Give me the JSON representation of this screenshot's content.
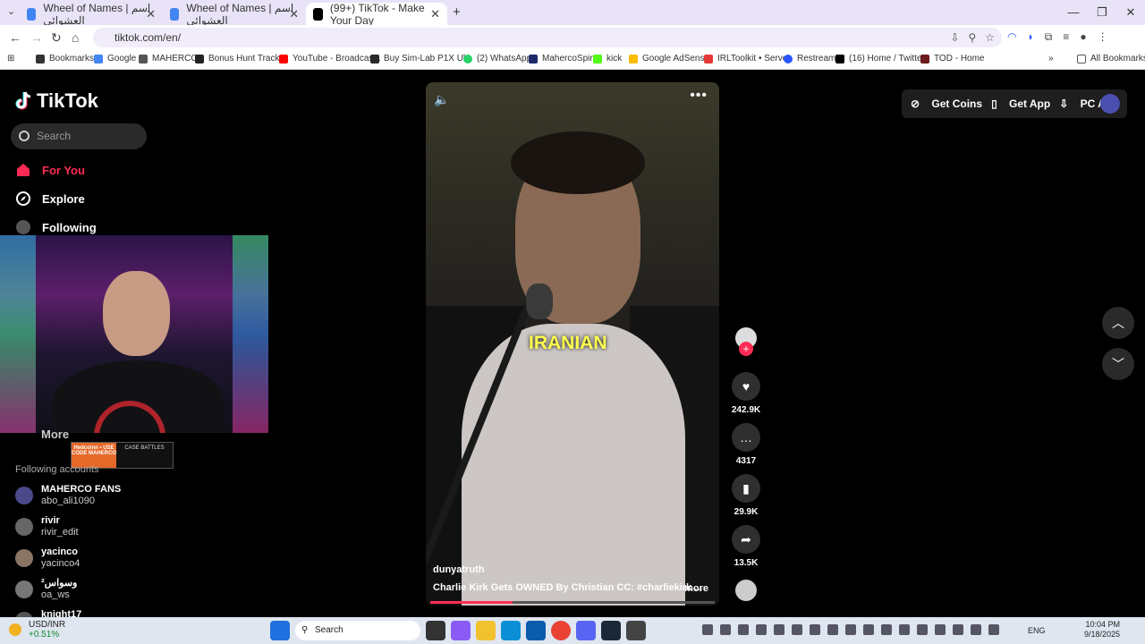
{
  "browser": {
    "tabs": [
      {
        "label": "Wheel of Names | اسم العشوائي",
        "active": false
      },
      {
        "label": "Wheel of Names | اسم العشوائي",
        "active": false
      },
      {
        "label": "(99+) TikTok - Make Your Day",
        "active": true
      }
    ],
    "new_tab": "+",
    "url": "tiktok.com/en/",
    "bookmarks": [
      {
        "label": "Bookmarks",
        "icon": "star-icon",
        "color": "#333333"
      },
      {
        "label": "Google",
        "icon": "google-icon",
        "color": "#4285f4"
      },
      {
        "label": "MAHERCO",
        "icon": "maherco-icon",
        "color": "#555555"
      },
      {
        "label": "Bonus Hunt Tracker",
        "icon": "tracker-icon",
        "color": "#222222"
      },
      {
        "label": "YouTube - Broadcas...",
        "icon": "youtube-icon",
        "color": "#ff0000"
      },
      {
        "label": "Buy Sim-Lab P1X Ul...",
        "icon": "simlab-icon",
        "color": "#2a2a2a"
      },
      {
        "label": "(2) WhatsApp",
        "icon": "whatsapp-icon",
        "color": "#25d366"
      },
      {
        "label": "MahercoSpin",
        "icon": "spin-icon",
        "color": "#1f2a6b"
      },
      {
        "label": "kick",
        "icon": "kick-icon",
        "color": "#53fc18"
      },
      {
        "label": "Google AdSense",
        "icon": "adsense-icon",
        "color": "#fbbc04"
      },
      {
        "label": "IRLToolkit • Server",
        "icon": "irl-icon",
        "color": "#e53935"
      },
      {
        "label": "Restream",
        "icon": "restream-icon",
        "color": "#2957ff"
      },
      {
        "label": "(16) Home / Twitter",
        "icon": "x-icon",
        "color": "#000000"
      },
      {
        "label": "TOD - Home",
        "icon": "tod-icon",
        "color": "#6b1b1b"
      }
    ],
    "all_bookmarks": "All Bookmarks"
  },
  "sidebar": {
    "logo": "TikTok",
    "search_placeholder": "Search",
    "nav": [
      {
        "label": "For You",
        "color": "#fe2c55"
      },
      {
        "label": "Explore",
        "color": "#ffffff"
      },
      {
        "label": "Following",
        "color": "#ffffff"
      }
    ],
    "more_label": "More",
    "badge_left": "Hedcoinn • USE CODE MAHERCO",
    "badge_right": "CASE BATTLES",
    "following_title": "Following accounts",
    "accounts": [
      {
        "name": "MAHERCO FANS",
        "user": "abo_ali1090"
      },
      {
        "name": "rivir",
        "user": "rivir_edit"
      },
      {
        "name": "yacinco",
        "user": "yacinco4"
      },
      {
        "name": "وسواس²",
        "user": "oa_ws"
      },
      {
        "name": "knight17",
        "user": ""
      }
    ]
  },
  "video": {
    "caption": "IRANIAN",
    "username": "dunyatruth",
    "description": "Charlie Kirk Gets OWNED By Christian   CC: #charliekirk  ...",
    "more": "more",
    "progress": 0.29
  },
  "actions": {
    "likes": "242.9K",
    "comments": "4317",
    "saves": "29.9K",
    "shares": "13.5K"
  },
  "topbar": {
    "get_coins": "Get Coins",
    "get_app": "Get App",
    "pc_app": "PC App"
  },
  "taskbar": {
    "ticker_name": "USD/INR",
    "ticker_change": "+0.51%",
    "search": "Search",
    "lang": "ENG",
    "time": "10:04 PM",
    "date": "9/18/2025"
  }
}
